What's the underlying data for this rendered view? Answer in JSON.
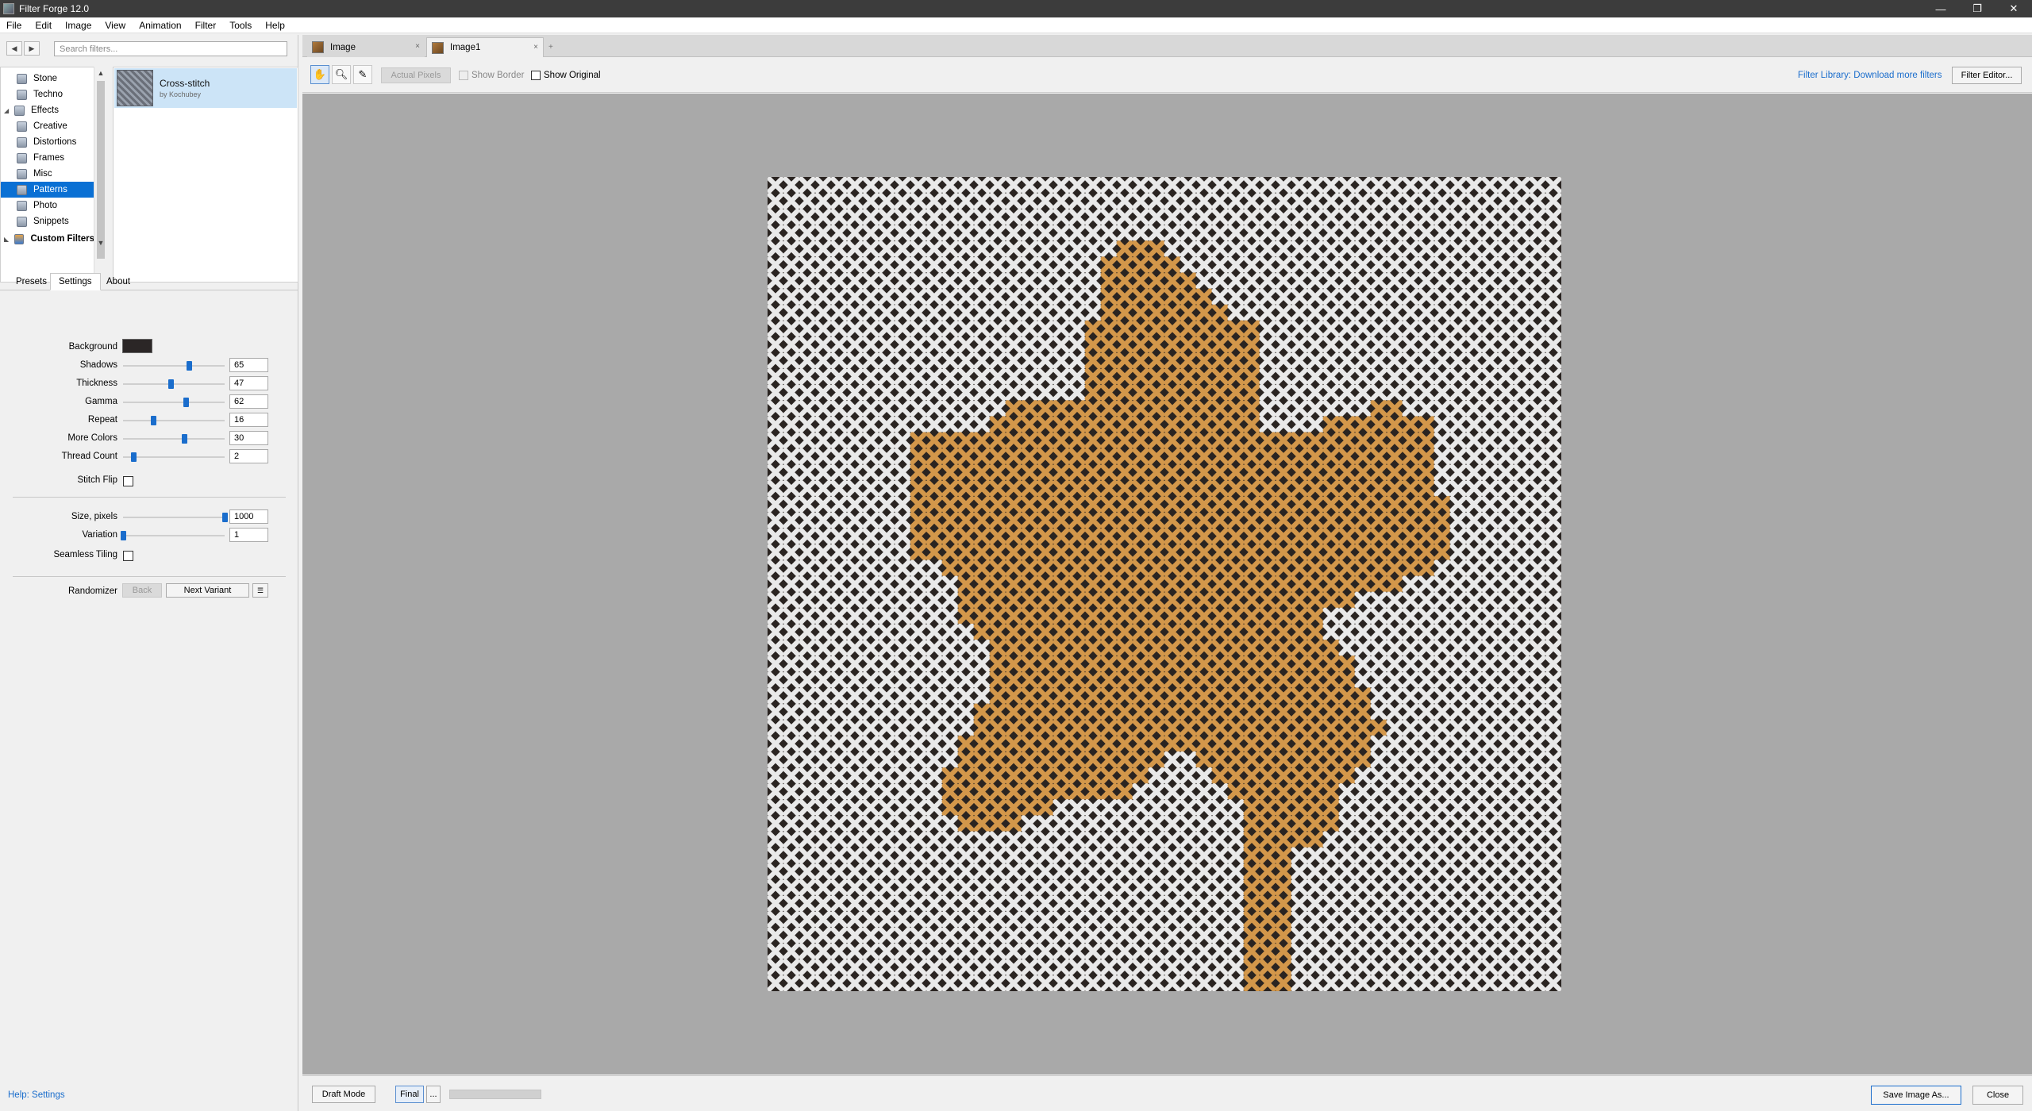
{
  "window": {
    "title": "Filter Forge 12.0",
    "controls": [
      "—",
      "❐",
      "✕"
    ]
  },
  "menu": [
    "File",
    "Edit",
    "Image",
    "View",
    "Animation",
    "Filter",
    "Tools",
    "Help"
  ],
  "search": {
    "placeholder": "Search filters..."
  },
  "tree": {
    "items": [
      {
        "label": "Stone",
        "level": 2
      },
      {
        "label": "Techno",
        "level": 2
      },
      {
        "label": "Effects",
        "level": 1,
        "expanded": true
      },
      {
        "label": "Creative",
        "level": 2
      },
      {
        "label": "Distortions",
        "level": 2
      },
      {
        "label": "Frames",
        "level": 2
      },
      {
        "label": "Misc",
        "level": 2
      },
      {
        "label": "Patterns",
        "level": 2,
        "selected": true
      },
      {
        "label": "Photo",
        "level": 2
      },
      {
        "label": "Snippets",
        "level": 2
      },
      {
        "label": "Custom Filters",
        "level": 1
      }
    ]
  },
  "filter": {
    "name": "Cross-stitch",
    "author": "by Kochubey"
  },
  "tabs": {
    "presets": "Presets",
    "settings": "Settings",
    "about": "About"
  },
  "settings": {
    "background_label": "Background",
    "background_color": "#2b2626",
    "sliders": [
      {
        "label": "Shadows",
        "value": "65",
        "fraction": 0.65
      },
      {
        "label": "Thickness",
        "value": "47",
        "fraction": 0.47
      },
      {
        "label": "Gamma",
        "value": "62",
        "fraction": 0.62
      },
      {
        "label": "Repeat",
        "value": "16",
        "fraction": 0.3
      },
      {
        "label": "More Colors",
        "value": "30",
        "fraction": 0.6
      },
      {
        "label": "Thread Count",
        "value": "2",
        "fraction": 0.1
      }
    ],
    "stitch_flip_label": "Stitch Flip",
    "size_label": "Size, pixels",
    "size_value": "1000",
    "size_fraction": 1.0,
    "variation_label": "Variation",
    "variation_value": "1",
    "variation_fraction": 0.0,
    "seamless_label": "Seamless Tiling",
    "randomizer_label": "Randomizer",
    "back_label": "Back",
    "next_variant_label": "Next Variant"
  },
  "help": "Help: Settings",
  "doc_tabs": [
    {
      "label": "Image",
      "close": "×"
    },
    {
      "label": "Image1",
      "close": "×"
    }
  ],
  "toolbar": {
    "actual_pixels": "Actual Pixels",
    "show_border": "Show Border",
    "show_original": "Show Original",
    "library_link": "Filter Library: Download more filters",
    "filter_editor": "Filter Editor..."
  },
  "status": {
    "draft_mode": "Draft Mode",
    "final": "Final",
    "more": "...",
    "save_image": "Save Image As...",
    "close": "Close"
  },
  "colors": {
    "accent": "#1a6dcc",
    "selection": "#0a70d4",
    "canvas_bg": "#a9a9a9",
    "leaf_orange": "#d3974a",
    "stitch_white": "#e9e9e9"
  }
}
